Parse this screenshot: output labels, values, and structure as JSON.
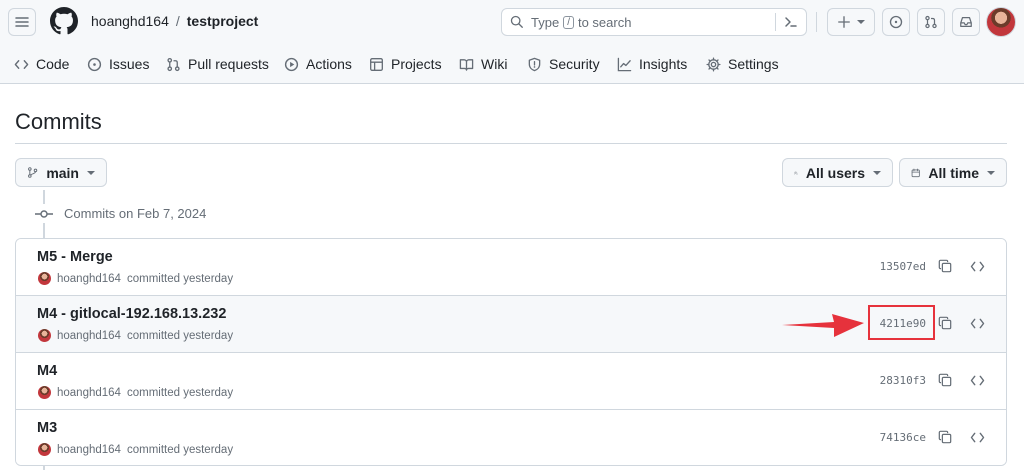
{
  "repo": {
    "owner": "hoanghd164",
    "separator": "/",
    "name": "testproject"
  },
  "search": {
    "prefix": "Type",
    "key": "/",
    "suffix": "to search"
  },
  "nav_tabs": [
    {
      "label": "Code",
      "icon": "code-icon"
    },
    {
      "label": "Issues",
      "icon": "issue-opened-icon"
    },
    {
      "label": "Pull requests",
      "icon": "git-pull-request-icon"
    },
    {
      "label": "Actions",
      "icon": "play-icon"
    },
    {
      "label": "Projects",
      "icon": "table-icon"
    },
    {
      "label": "Wiki",
      "icon": "book-icon"
    },
    {
      "label": "Security",
      "icon": "shield-icon"
    },
    {
      "label": "Insights",
      "icon": "graph-icon"
    },
    {
      "label": "Settings",
      "icon": "gear-icon"
    }
  ],
  "page": {
    "title": "Commits"
  },
  "filters": {
    "branch": "main",
    "users": "All users",
    "time": "All time"
  },
  "group": {
    "label": "Commits on Feb 7, 2024"
  },
  "commits": [
    {
      "title": "M5 - Merge",
      "author": "hoanghd164",
      "meta": "committed yesterday",
      "sha": "13507ed"
    },
    {
      "title": "M4 - gitlocal-192.168.13.232",
      "author": "hoanghd164",
      "meta": "committed yesterday",
      "sha": "4211e90"
    },
    {
      "title": "M4",
      "author": "hoanghd164",
      "meta": "committed yesterday",
      "sha": "28310f3"
    },
    {
      "title": "M3",
      "author": "hoanghd164",
      "meta": "committed yesterday",
      "sha": "74136ce"
    }
  ],
  "colors": {
    "annotation": "#e6323c",
    "border": "#d0d7de",
    "muted": "#656d76"
  }
}
